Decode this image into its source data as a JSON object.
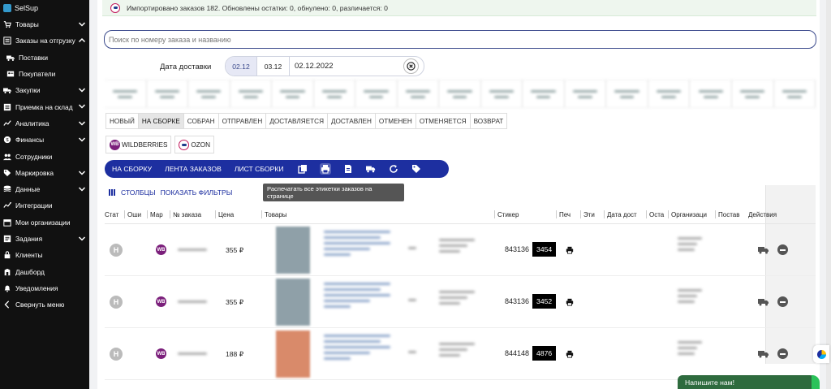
{
  "sidebar": {
    "brand": "SelSup",
    "items": [
      {
        "label": "Товары",
        "icon": "cart-icon",
        "chevron": "down"
      },
      {
        "label": "Заказы на отгрузку",
        "icon": "orders-icon",
        "chevron": "up"
      },
      {
        "label": "Поставки",
        "icon": "truck-icon",
        "chevron": "",
        "sub": true
      },
      {
        "label": "Покупатели",
        "icon": "contact-card-icon",
        "chevron": "",
        "sub": true
      },
      {
        "label": "Закупки",
        "icon": "truck-icon",
        "chevron": "down"
      },
      {
        "label": "Приемка на склад",
        "icon": "list-icon",
        "chevron": "down"
      },
      {
        "label": "Аналитика",
        "icon": "chart-line-icon",
        "chevron": "down"
      },
      {
        "label": "Финансы",
        "icon": "dollar-icon",
        "chevron": "down"
      },
      {
        "label": "Сотрудники",
        "icon": "people-icon",
        "chevron": ""
      },
      {
        "label": "Маркировка",
        "icon": "tag-icon",
        "chevron": "down"
      },
      {
        "label": "Данные",
        "icon": "database-icon",
        "chevron": "down"
      },
      {
        "label": "Интеграции",
        "icon": "integration-icon",
        "chevron": ""
      },
      {
        "label": "Мои организации",
        "icon": "store-icon",
        "chevron": ""
      },
      {
        "label": "Задания",
        "icon": "tasks-icon",
        "chevron": "down"
      },
      {
        "label": "Клиенты",
        "icon": "lock-icon",
        "chevron": ""
      },
      {
        "label": "Дашборд",
        "icon": "dashboard-icon",
        "chevron": ""
      },
      {
        "label": "Уведомления",
        "icon": "bell-icon",
        "chevron": ""
      },
      {
        "label": "Свернуть меню",
        "icon": "chevron-left-icon",
        "chevron": ""
      }
    ]
  },
  "import_status": "Импортировано заказов 182. Обновлены остатки: 0, обнулено: 0, различается: 0",
  "search": {
    "placeholder": "Поиск по номеру заказа и названию"
  },
  "delivery": {
    "label": "Дата доставки",
    "chips": [
      "02.12",
      "03.12"
    ],
    "date_value": "02.12.2022"
  },
  "status_tabs": [
    "Новый",
    "На сборке",
    "Собран",
    "Отправлен",
    "Доставляется",
    "Доставлен",
    "Отменен",
    "Отменяется",
    "Возврат"
  ],
  "active_status": "На сборке",
  "marketplaces": {
    "wb_badge": "WB",
    "wb": "Wildberries",
    "ozon": "Ozon"
  },
  "toolbar": {
    "buttons": [
      "На сборку",
      "Лента заказов",
      "Лист сборки"
    ],
    "icons": [
      "copy-icon",
      "print-icon",
      "document-icon",
      "truck-icon",
      "refresh-icon",
      "tag-icon"
    ]
  },
  "tooltip": "Распечатать все этикетки заказов на странице",
  "filters": {
    "columns": "Столбцы",
    "show_filters": "Показать фильтры"
  },
  "columns": [
    "Стат",
    "Оши",
    "Мар",
    "№ заказа",
    "Цена",
    "Товары",
    "Стикер",
    "Печ",
    "Эти",
    "Дата дост",
    "Оста",
    "Организаци",
    "Постав",
    "Действия"
  ],
  "rows": [
    {
      "status": "Н",
      "mp": "WB",
      "price": "355 ₽",
      "sticker_num": "843136",
      "sticker_code": "3454",
      "thumb_color": "#8fa0a8"
    },
    {
      "status": "Н",
      "mp": "WB",
      "price": "355 ₽",
      "sticker_num": "843136",
      "sticker_code": "3452",
      "thumb_color": "#8fa0a8"
    },
    {
      "status": "Н",
      "mp": "WB",
      "price": "188 ₽",
      "sticker_num": "844148",
      "sticker_code": "4876",
      "thumb_color": "#d98a6a"
    }
  ],
  "chat": {
    "label": "Напишите нам!"
  },
  "colors": {
    "toolbar": "#1d2fa0",
    "sidebar": "#111111",
    "wb": "#7b1f7b",
    "chat": "#2e6b3e"
  }
}
